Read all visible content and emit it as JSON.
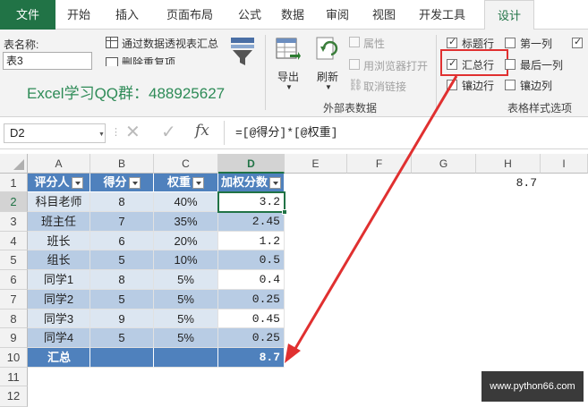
{
  "tabs": [
    "文件",
    "开始",
    "插入",
    "页面布局",
    "公式",
    "数据",
    "审阅",
    "视图",
    "开发工具",
    "设计"
  ],
  "ribbon": {
    "table_name_label": "表名称:",
    "table_name_value": "表3",
    "pivot_summary": "通过数据透视表汇总",
    "remove_duplicates": "删除重复项",
    "export": "导出",
    "refresh": "刷新",
    "properties": "属性",
    "open_in_browser": "用浏览器打开",
    "unlink": "取消链接",
    "external_group": "外部表数据",
    "style_group": "表格样式选项",
    "options": {
      "header_row": "标题行",
      "first_column": "第一列",
      "total_row": "汇总行",
      "last_column": "最后一列",
      "banded_rows": "镶边行",
      "banded_columns": "镶边列"
    },
    "watermark": "Excel学习QQ群：488925627"
  },
  "formula_bar": {
    "name_box": "D2",
    "fx": "fx",
    "cancel_icon": "✕",
    "confirm_icon": "✓",
    "formula": "=[@得分]*[@权重]"
  },
  "columns": [
    "A",
    "B",
    "C",
    "D",
    "E",
    "F",
    "G",
    "H",
    "I"
  ],
  "rows": [
    "1",
    "2",
    "3",
    "4",
    "5",
    "6",
    "7",
    "8",
    "9",
    "10",
    "11",
    "12"
  ],
  "table": {
    "headers": [
      "评分人",
      "得分",
      "权重",
      "加权分数"
    ],
    "data": [
      [
        "科目老师",
        "8",
        "40%",
        "3.2"
      ],
      [
        "班主任",
        "7",
        "35%",
        "2.45"
      ],
      [
        "班长",
        "6",
        "20%",
        "1.2"
      ],
      [
        "组长",
        "5",
        "10%",
        "0.5"
      ],
      [
        "同学1",
        "8",
        "5%",
        "0.4"
      ],
      [
        "同学2",
        "5",
        "5%",
        "0.25"
      ],
      [
        "同学3",
        "9",
        "5%",
        "0.45"
      ],
      [
        "同学4",
        "5",
        "5%",
        "0.25"
      ]
    ],
    "total_label": "汇总",
    "total_value": "8.7"
  },
  "h1_value": "8.7",
  "site_watermark": "www.python66.com",
  "colors": {
    "excel_green": "#217346",
    "table_header": "#4f81bd",
    "band_light": "#dce6f1",
    "band_dark": "#b8cce4",
    "highlight_red": "#e03030"
  }
}
